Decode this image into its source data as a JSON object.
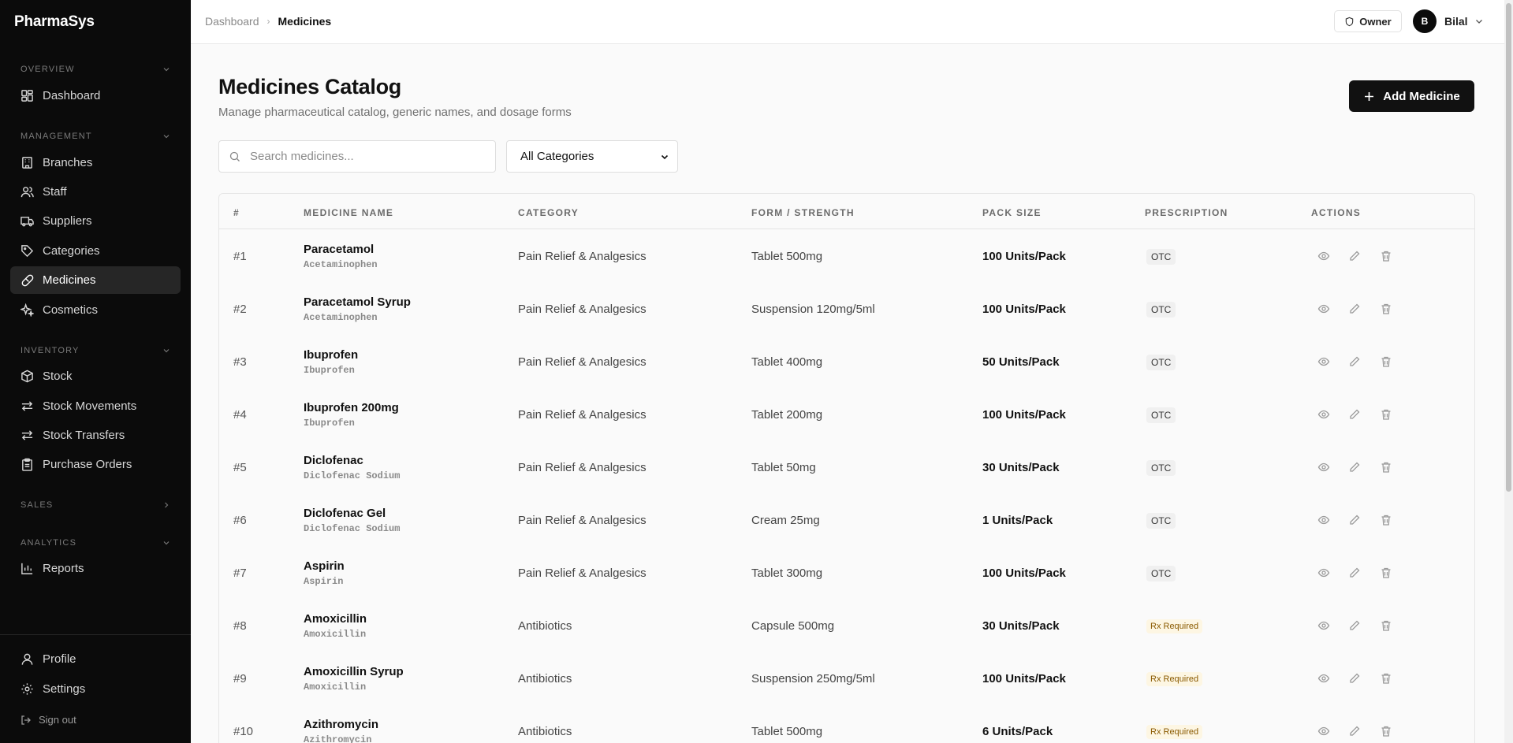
{
  "app": {
    "brand": "PharmaSys"
  },
  "sidebar": {
    "sections": {
      "overview": "OVERVIEW",
      "management": "MANAGEMENT",
      "inventory": "INVENTORY",
      "sales": "SALES",
      "analytics": "ANALYTICS"
    },
    "items": {
      "dashboard": "Dashboard",
      "branches": "Branches",
      "staff": "Staff",
      "suppliers": "Suppliers",
      "categories": "Categories",
      "medicines": "Medicines",
      "cosmetics": "Cosmetics",
      "stock": "Stock",
      "stock_movements": "Stock Movements",
      "stock_transfers": "Stock Transfers",
      "purchase_orders": "Purchase Orders",
      "reports": "Reports",
      "profile": "Profile",
      "settings": "Settings",
      "sign_out": "Sign out"
    }
  },
  "topbar": {
    "breadcrumb": [
      "Dashboard",
      "Medicines"
    ],
    "role": "Owner",
    "user_initial": "B",
    "user_name": "Bilal"
  },
  "page": {
    "title": "Medicines Catalog",
    "subtitle": "Manage pharmaceutical catalog, generic names, and dosage forms",
    "add_button": "Add Medicine",
    "search_placeholder": "Search medicines...",
    "category_filter": "All Categories"
  },
  "table": {
    "headers": [
      "#",
      "MEDICINE NAME",
      "CATEGORY",
      "FORM / STRENGTH",
      "PACK SIZE",
      "PRESCRIPTION",
      "ACTIONS"
    ],
    "rows": [
      {
        "num": "#1",
        "name": "Paracetamol",
        "generic": "Acetaminophen",
        "category": "Pain Relief & Analgesics",
        "form": "Tablet 500mg",
        "pack": "100 Units/Pack",
        "rx": "OTC"
      },
      {
        "num": "#2",
        "name": "Paracetamol Syrup",
        "generic": "Acetaminophen",
        "category": "Pain Relief & Analgesics",
        "form": "Suspension 120mg/5ml",
        "pack": "100 Units/Pack",
        "rx": "OTC"
      },
      {
        "num": "#3",
        "name": "Ibuprofen",
        "generic": "Ibuprofen",
        "category": "Pain Relief & Analgesics",
        "form": "Tablet 400mg",
        "pack": "50 Units/Pack",
        "rx": "OTC"
      },
      {
        "num": "#4",
        "name": "Ibuprofen 200mg",
        "generic": "Ibuprofen",
        "category": "Pain Relief & Analgesics",
        "form": "Tablet 200mg",
        "pack": "100 Units/Pack",
        "rx": "OTC"
      },
      {
        "num": "#5",
        "name": "Diclofenac",
        "generic": "Diclofenac Sodium",
        "category": "Pain Relief & Analgesics",
        "form": "Tablet 50mg",
        "pack": "30 Units/Pack",
        "rx": "OTC"
      },
      {
        "num": "#6",
        "name": "Diclofenac Gel",
        "generic": "Diclofenac Sodium",
        "category": "Pain Relief & Analgesics",
        "form": "Cream 25mg",
        "pack": "1 Units/Pack",
        "rx": "OTC"
      },
      {
        "num": "#7",
        "name": "Aspirin",
        "generic": "Aspirin",
        "category": "Pain Relief & Analgesics",
        "form": "Tablet 300mg",
        "pack": "100 Units/Pack",
        "rx": "OTC"
      },
      {
        "num": "#8",
        "name": "Amoxicillin",
        "generic": "Amoxicillin",
        "category": "Antibiotics",
        "form": "Capsule 500mg",
        "pack": "30 Units/Pack",
        "rx": "Rx Required"
      },
      {
        "num": "#9",
        "name": "Amoxicillin Syrup",
        "generic": "Amoxicillin",
        "category": "Antibiotics",
        "form": "Suspension 250mg/5ml",
        "pack": "100 Units/Pack",
        "rx": "Rx Required"
      },
      {
        "num": "#10",
        "name": "Azithromycin",
        "generic": "Azithromycin",
        "category": "Antibiotics",
        "form": "Tablet 500mg",
        "pack": "6 Units/Pack",
        "rx": "Rx Required"
      }
    ]
  }
}
